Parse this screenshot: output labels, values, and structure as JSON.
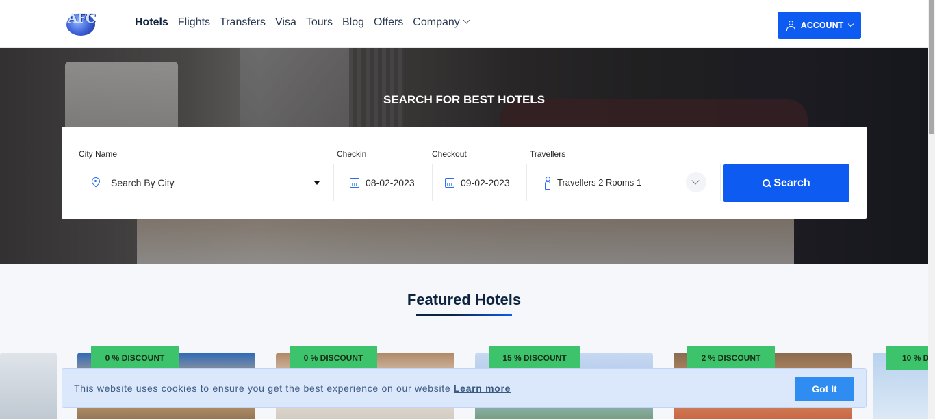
{
  "logo": {
    "text": "AFC"
  },
  "nav": {
    "items": [
      {
        "label": "Hotels",
        "active": true
      },
      {
        "label": "Flights"
      },
      {
        "label": "Transfers"
      },
      {
        "label": "Visa"
      },
      {
        "label": "Tours"
      },
      {
        "label": "Blog"
      },
      {
        "label": "Offers"
      },
      {
        "label": "Company",
        "dropdown": true
      }
    ]
  },
  "account": {
    "label": "ACCOUNT",
    "icon": "user-icon"
  },
  "hero": {
    "title": "SEARCH FOR BEST HOTELS"
  },
  "search": {
    "city_label": "City Name",
    "city_value": "Search By City",
    "checkin_label": "Checkin",
    "checkin_value": "08-02-2023",
    "checkout_label": "Checkout",
    "checkout_value": "09-02-2023",
    "travellers_label": "Travellers",
    "travellers_value": "Travellers 2 Rooms 1",
    "search_button": "Search"
  },
  "featured": {
    "title": "Featured Hotels",
    "discounts": [
      "0 % DISCOUNT",
      "0 % DISCOUNT",
      "15 % DISCOUNT",
      "2 % DISCOUNT",
      "10 % DI"
    ]
  },
  "cookie": {
    "message": "This website uses cookies to ensure you get the best experience on our website ",
    "link": "Learn more",
    "button": "Got It"
  },
  "colors": {
    "primary": "#0d5bf0",
    "discount_badge": "#3cc36b",
    "cookie_bg": "#dbe7fb",
    "heading": "#0d233e"
  }
}
